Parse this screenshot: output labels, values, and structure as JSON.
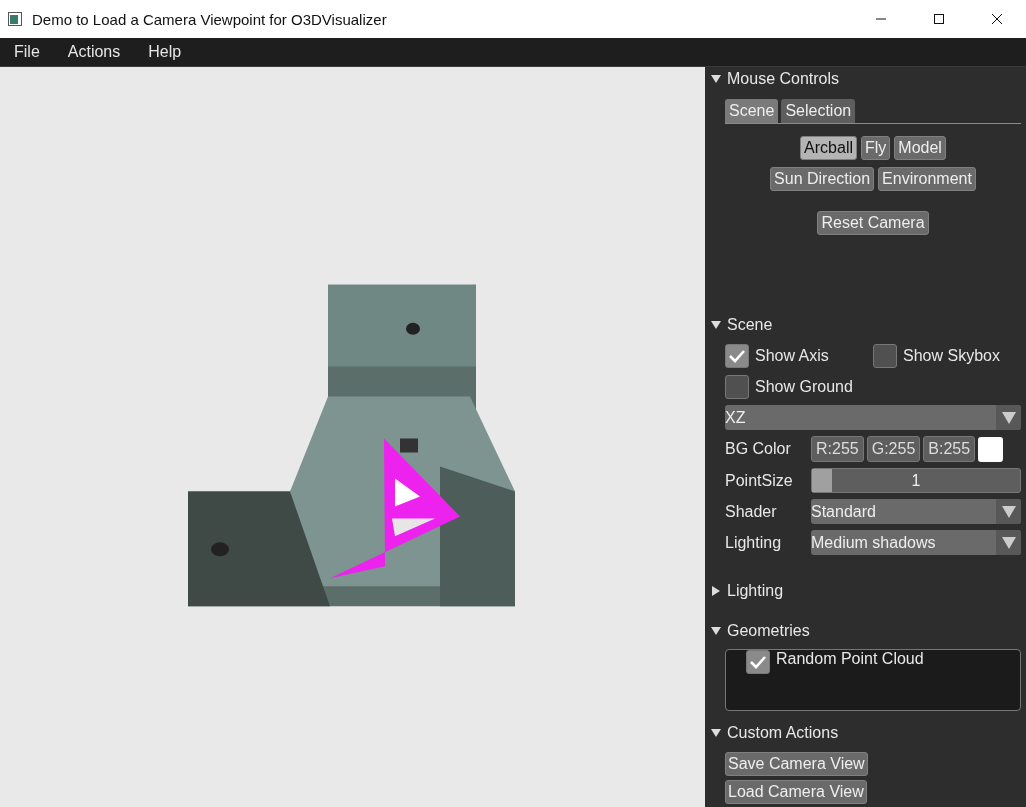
{
  "window": {
    "title": "Demo to Load a Camera Viewpoint for O3DVisualizer"
  },
  "menu": [
    {
      "label": "File"
    },
    {
      "label": "Actions"
    },
    {
      "label": "Help"
    }
  ],
  "mouse_controls": {
    "title": "Mouse Controls",
    "expanded": true,
    "tabs": [
      {
        "label": "Scene",
        "selected": true
      },
      {
        "label": "Selection",
        "selected": false
      }
    ],
    "mode_rows": [
      [
        {
          "label": "Arcball",
          "selected": true
        },
        {
          "label": "Fly",
          "selected": false
        },
        {
          "label": "Model",
          "selected": false
        }
      ],
      [
        {
          "label": "Sun Direction",
          "selected": false
        },
        {
          "label": "Environment",
          "selected": false
        }
      ]
    ],
    "reset_button": "Reset Camera"
  },
  "scene": {
    "title": "Scene",
    "expanded": true,
    "checkbox_rows": [
      [
        {
          "label": "Show Axis",
          "checked": true
        },
        {
          "label": "Show Skybox",
          "checked": false
        }
      ],
      [
        {
          "label": "Show Ground",
          "checked": false
        }
      ]
    ],
    "plane_dropdown": {
      "value": "XZ"
    },
    "bg_color": {
      "label": "BG Color",
      "channels": [
        "R:255",
        "G:255",
        "B:255"
      ]
    },
    "point_size": {
      "label": "PointSize",
      "value": "1",
      "level": 0.05
    },
    "shader": {
      "label": "Shader",
      "value": "Standard"
    },
    "lighting": {
      "label": "Lighting",
      "value": "Medium shadows"
    }
  },
  "lighting_section": {
    "title": "Lighting",
    "expanded": false
  },
  "geometries": {
    "title": "Geometries",
    "expanded": true,
    "items": [
      {
        "label": "Random Point Cloud",
        "checked": true
      }
    ]
  },
  "custom_actions": {
    "title": "Custom Actions",
    "expanded": true,
    "buttons": [
      "Save Camera View",
      "Load Camera View"
    ]
  }
}
